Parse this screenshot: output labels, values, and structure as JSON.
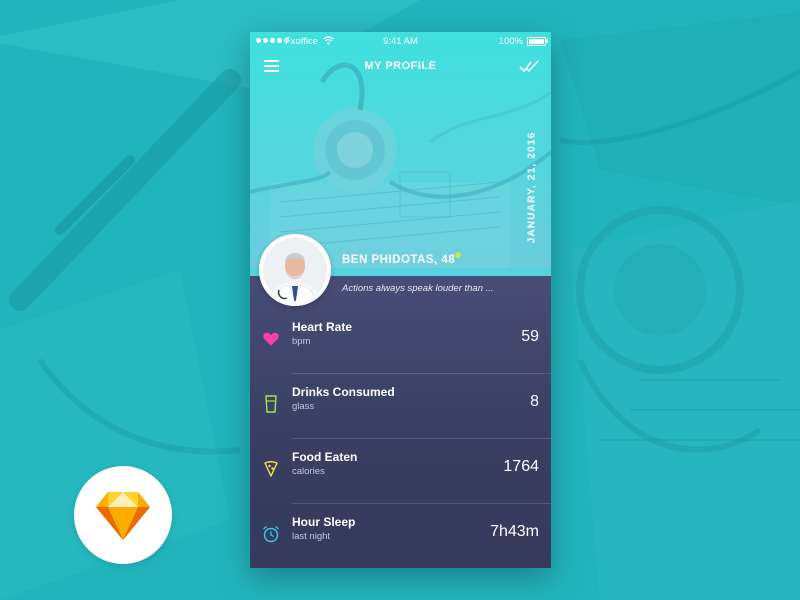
{
  "status_bar": {
    "carrier": "Fxoffice",
    "time": "9:41 AM",
    "battery": "100%"
  },
  "nav": {
    "title": "MY PROFILE",
    "menu_icon": "hamburger-menu-icon",
    "action_icon": "double-check-icon"
  },
  "profile": {
    "date": "JANUARY, 21, 2016",
    "name": "BEN PHIDOTAS, 48",
    "quote": "Actions always speak louder than ...",
    "online_color": "#c8e65a"
  },
  "stats": [
    {
      "title": "Heart Rate",
      "unit": "bpm",
      "value": "59",
      "icon": "heart-icon",
      "color": "#ff3da6"
    },
    {
      "title": "Drinks Consumed",
      "unit": "glass",
      "value": "8",
      "icon": "glass-icon",
      "color": "#a9e34b"
    },
    {
      "title": "Food Eaten",
      "unit": "calories",
      "value": "1764",
      "icon": "pizza-icon",
      "color": "#f7e14a"
    },
    {
      "title": "Hour Sleep",
      "unit": "last night",
      "value": "7h43m",
      "icon": "alarm-clock-icon",
      "color": "#37c8e6"
    }
  ],
  "colors": {
    "background": "#25b7c0",
    "header": "#3fe0df",
    "panel": "#3d4266",
    "sketch_orange": "#f5a623"
  }
}
